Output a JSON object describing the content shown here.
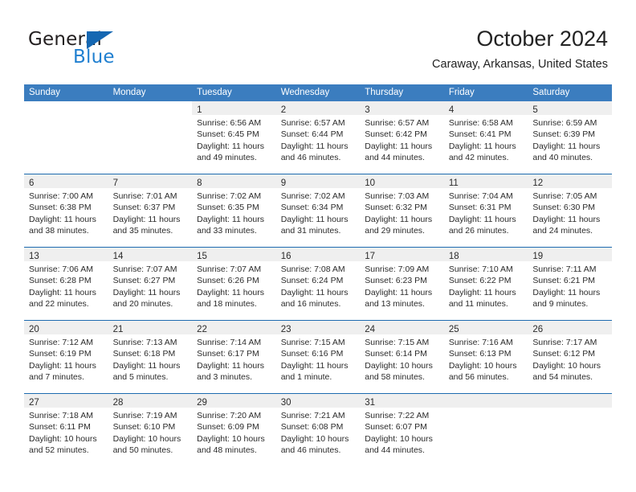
{
  "logo": {
    "word1": "General",
    "word2": "Blue",
    "triangle_color": "#1567b2",
    "blue_color": "#1f7fd0"
  },
  "header": {
    "month_title": "October 2024",
    "location": "Caraway, Arkansas, United States"
  },
  "theme": {
    "header_row_bg": "#3b7dbf",
    "row_divider": "#1d6bb0",
    "daynum_band_bg": "#efefef"
  },
  "weekday_headers": [
    "Sunday",
    "Monday",
    "Tuesday",
    "Wednesday",
    "Thursday",
    "Friday",
    "Saturday"
  ],
  "weeks": [
    [
      {
        "day": "",
        "sunrise": "",
        "sunset": "",
        "daylight1": "",
        "daylight2": "",
        "blank": true
      },
      {
        "day": "",
        "sunrise": "",
        "sunset": "",
        "daylight1": "",
        "daylight2": "",
        "blank": true
      },
      {
        "day": "1",
        "sunrise": "Sunrise: 6:56 AM",
        "sunset": "Sunset: 6:45 PM",
        "daylight1": "Daylight: 11 hours",
        "daylight2": "and 49 minutes."
      },
      {
        "day": "2",
        "sunrise": "Sunrise: 6:57 AM",
        "sunset": "Sunset: 6:44 PM",
        "daylight1": "Daylight: 11 hours",
        "daylight2": "and 46 minutes."
      },
      {
        "day": "3",
        "sunrise": "Sunrise: 6:57 AM",
        "sunset": "Sunset: 6:42 PM",
        "daylight1": "Daylight: 11 hours",
        "daylight2": "and 44 minutes."
      },
      {
        "day": "4",
        "sunrise": "Sunrise: 6:58 AM",
        "sunset": "Sunset: 6:41 PM",
        "daylight1": "Daylight: 11 hours",
        "daylight2": "and 42 minutes."
      },
      {
        "day": "5",
        "sunrise": "Sunrise: 6:59 AM",
        "sunset": "Sunset: 6:39 PM",
        "daylight1": "Daylight: 11 hours",
        "daylight2": "and 40 minutes."
      }
    ],
    [
      {
        "day": "6",
        "sunrise": "Sunrise: 7:00 AM",
        "sunset": "Sunset: 6:38 PM",
        "daylight1": "Daylight: 11 hours",
        "daylight2": "and 38 minutes."
      },
      {
        "day": "7",
        "sunrise": "Sunrise: 7:01 AM",
        "sunset": "Sunset: 6:37 PM",
        "daylight1": "Daylight: 11 hours",
        "daylight2": "and 35 minutes."
      },
      {
        "day": "8",
        "sunrise": "Sunrise: 7:02 AM",
        "sunset": "Sunset: 6:35 PM",
        "daylight1": "Daylight: 11 hours",
        "daylight2": "and 33 minutes."
      },
      {
        "day": "9",
        "sunrise": "Sunrise: 7:02 AM",
        "sunset": "Sunset: 6:34 PM",
        "daylight1": "Daylight: 11 hours",
        "daylight2": "and 31 minutes."
      },
      {
        "day": "10",
        "sunrise": "Sunrise: 7:03 AM",
        "sunset": "Sunset: 6:32 PM",
        "daylight1": "Daylight: 11 hours",
        "daylight2": "and 29 minutes."
      },
      {
        "day": "11",
        "sunrise": "Sunrise: 7:04 AM",
        "sunset": "Sunset: 6:31 PM",
        "daylight1": "Daylight: 11 hours",
        "daylight2": "and 26 minutes."
      },
      {
        "day": "12",
        "sunrise": "Sunrise: 7:05 AM",
        "sunset": "Sunset: 6:30 PM",
        "daylight1": "Daylight: 11 hours",
        "daylight2": "and 24 minutes."
      }
    ],
    [
      {
        "day": "13",
        "sunrise": "Sunrise: 7:06 AM",
        "sunset": "Sunset: 6:28 PM",
        "daylight1": "Daylight: 11 hours",
        "daylight2": "and 22 minutes."
      },
      {
        "day": "14",
        "sunrise": "Sunrise: 7:07 AM",
        "sunset": "Sunset: 6:27 PM",
        "daylight1": "Daylight: 11 hours",
        "daylight2": "and 20 minutes."
      },
      {
        "day": "15",
        "sunrise": "Sunrise: 7:07 AM",
        "sunset": "Sunset: 6:26 PM",
        "daylight1": "Daylight: 11 hours",
        "daylight2": "and 18 minutes."
      },
      {
        "day": "16",
        "sunrise": "Sunrise: 7:08 AM",
        "sunset": "Sunset: 6:24 PM",
        "daylight1": "Daylight: 11 hours",
        "daylight2": "and 16 minutes."
      },
      {
        "day": "17",
        "sunrise": "Sunrise: 7:09 AM",
        "sunset": "Sunset: 6:23 PM",
        "daylight1": "Daylight: 11 hours",
        "daylight2": "and 13 minutes."
      },
      {
        "day": "18",
        "sunrise": "Sunrise: 7:10 AM",
        "sunset": "Sunset: 6:22 PM",
        "daylight1": "Daylight: 11 hours",
        "daylight2": "and 11 minutes."
      },
      {
        "day": "19",
        "sunrise": "Sunrise: 7:11 AM",
        "sunset": "Sunset: 6:21 PM",
        "daylight1": "Daylight: 11 hours",
        "daylight2": "and 9 minutes."
      }
    ],
    [
      {
        "day": "20",
        "sunrise": "Sunrise: 7:12 AM",
        "sunset": "Sunset: 6:19 PM",
        "daylight1": "Daylight: 11 hours",
        "daylight2": "and 7 minutes."
      },
      {
        "day": "21",
        "sunrise": "Sunrise: 7:13 AM",
        "sunset": "Sunset: 6:18 PM",
        "daylight1": "Daylight: 11 hours",
        "daylight2": "and 5 minutes."
      },
      {
        "day": "22",
        "sunrise": "Sunrise: 7:14 AM",
        "sunset": "Sunset: 6:17 PM",
        "daylight1": "Daylight: 11 hours",
        "daylight2": "and 3 minutes."
      },
      {
        "day": "23",
        "sunrise": "Sunrise: 7:15 AM",
        "sunset": "Sunset: 6:16 PM",
        "daylight1": "Daylight: 11 hours",
        "daylight2": "and 1 minute."
      },
      {
        "day": "24",
        "sunrise": "Sunrise: 7:15 AM",
        "sunset": "Sunset: 6:14 PM",
        "daylight1": "Daylight: 10 hours",
        "daylight2": "and 58 minutes."
      },
      {
        "day": "25",
        "sunrise": "Sunrise: 7:16 AM",
        "sunset": "Sunset: 6:13 PM",
        "daylight1": "Daylight: 10 hours",
        "daylight2": "and 56 minutes."
      },
      {
        "day": "26",
        "sunrise": "Sunrise: 7:17 AM",
        "sunset": "Sunset: 6:12 PM",
        "daylight1": "Daylight: 10 hours",
        "daylight2": "and 54 minutes."
      }
    ],
    [
      {
        "day": "27",
        "sunrise": "Sunrise: 7:18 AM",
        "sunset": "Sunset: 6:11 PM",
        "daylight1": "Daylight: 10 hours",
        "daylight2": "and 52 minutes."
      },
      {
        "day": "28",
        "sunrise": "Sunrise: 7:19 AM",
        "sunset": "Sunset: 6:10 PM",
        "daylight1": "Daylight: 10 hours",
        "daylight2": "and 50 minutes."
      },
      {
        "day": "29",
        "sunrise": "Sunrise: 7:20 AM",
        "sunset": "Sunset: 6:09 PM",
        "daylight1": "Daylight: 10 hours",
        "daylight2": "and 48 minutes."
      },
      {
        "day": "30",
        "sunrise": "Sunrise: 7:21 AM",
        "sunset": "Sunset: 6:08 PM",
        "daylight1": "Daylight: 10 hours",
        "daylight2": "and 46 minutes."
      },
      {
        "day": "31",
        "sunrise": "Sunrise: 7:22 AM",
        "sunset": "Sunset: 6:07 PM",
        "daylight1": "Daylight: 10 hours",
        "daylight2": "and 44 minutes."
      },
      {
        "day": "",
        "sunrise": "",
        "sunset": "",
        "daylight1": "",
        "daylight2": "",
        "empty": true
      },
      {
        "day": "",
        "sunrise": "",
        "sunset": "",
        "daylight1": "",
        "daylight2": "",
        "empty": true
      }
    ]
  ]
}
